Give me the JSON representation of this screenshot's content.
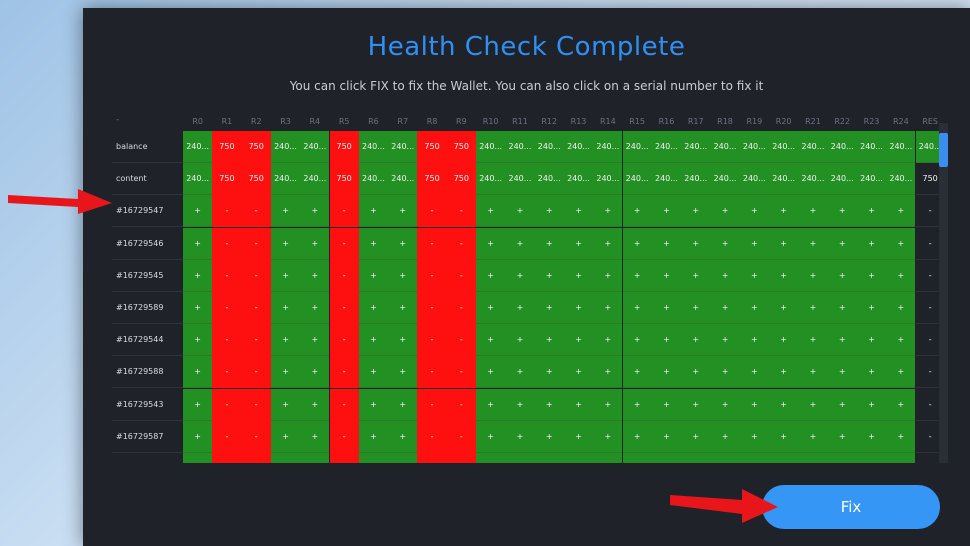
{
  "dialog": {
    "title": "Health Check Complete",
    "subtitle": "You can click FIX to fix the Wallet. You can also click on a serial number to fix it"
  },
  "table": {
    "corner": "-",
    "columns": [
      "R0",
      "R1",
      "R2",
      "R3",
      "R4",
      "R5",
      "R6",
      "R7",
      "R8",
      "R9",
      "R10",
      "R11",
      "R12",
      "R13",
      "R14",
      "R15",
      "R16",
      "R17",
      "R18",
      "R19",
      "R20",
      "R21",
      "R22",
      "R23",
      "R24",
      "RES"
    ],
    "column_status": [
      "pass",
      "fail",
      "fail",
      "pass",
      "pass",
      "fail",
      "pass",
      "pass",
      "fail",
      "fail",
      "pass",
      "pass",
      "pass",
      "pass",
      "pass",
      "pass",
      "pass",
      "pass",
      "pass",
      "pass",
      "pass",
      "pass",
      "pass",
      "pass",
      "pass",
      "none"
    ],
    "rows": [
      {
        "label": "balance",
        "cells": [
          "240...",
          "750",
          "750",
          "240...",
          "240...",
          "750",
          "240...",
          "240...",
          "750",
          "750",
          "240...",
          "240...",
          "240...",
          "240...",
          "240...",
          "240...",
          "240...",
          "240...",
          "240...",
          "240...",
          "240...",
          "240...",
          "240...",
          "240...",
          "240...",
          "240..."
        ]
      },
      {
        "label": "content",
        "cells": [
          "240...",
          "750",
          "750",
          "240...",
          "240...",
          "750",
          "240...",
          "240...",
          "750",
          "750",
          "240...",
          "240...",
          "240...",
          "240...",
          "240...",
          "240...",
          "240...",
          "240...",
          "240...",
          "240...",
          "240...",
          "240...",
          "240...",
          "240...",
          "240...",
          "750"
        ]
      },
      {
        "label": "#16729547",
        "cells": [
          "+",
          "-",
          "-",
          "+",
          "+",
          "-",
          "+",
          "+",
          "-",
          "-",
          "+",
          "+",
          "+",
          "+",
          "+",
          "+",
          "+",
          "+",
          "+",
          "+",
          "+",
          "+",
          "+",
          "+",
          "+",
          "-"
        ]
      },
      {
        "label": "#16729546",
        "cells": [
          "+",
          "-",
          "-",
          "+",
          "+",
          "-",
          "+",
          "+",
          "-",
          "-",
          "+",
          "+",
          "+",
          "+",
          "+",
          "+",
          "+",
          "+",
          "+",
          "+",
          "+",
          "+",
          "+",
          "+",
          "+",
          "-"
        ]
      },
      {
        "label": "#16729545",
        "cells": [
          "+",
          "-",
          "-",
          "+",
          "+",
          "-",
          "+",
          "+",
          "-",
          "-",
          "+",
          "+",
          "+",
          "+",
          "+",
          "+",
          "+",
          "+",
          "+",
          "+",
          "+",
          "+",
          "+",
          "+",
          "+",
          "-"
        ]
      },
      {
        "label": "#16729589",
        "cells": [
          "+",
          "-",
          "-",
          "+",
          "+",
          "-",
          "+",
          "+",
          "-",
          "-",
          "+",
          "+",
          "+",
          "+",
          "+",
          "+",
          "+",
          "+",
          "+",
          "+",
          "+",
          "+",
          "+",
          "+",
          "+",
          "-"
        ]
      },
      {
        "label": "#16729544",
        "cells": [
          "+",
          "-",
          "-",
          "+",
          "+",
          "-",
          "+",
          "+",
          "-",
          "-",
          "+",
          "+",
          "+",
          "+",
          "+",
          "+",
          "+",
          "+",
          "+",
          "+",
          "+",
          "+",
          "+",
          "+",
          "+",
          "-"
        ]
      },
      {
        "label": "#16729588",
        "cells": [
          "+",
          "-",
          "-",
          "+",
          "+",
          "-",
          "+",
          "+",
          "-",
          "-",
          "+",
          "+",
          "+",
          "+",
          "+",
          "+",
          "+",
          "+",
          "+",
          "+",
          "+",
          "+",
          "+",
          "+",
          "+",
          "-"
        ]
      },
      {
        "label": "#16729543",
        "cells": [
          "+",
          "-",
          "-",
          "+",
          "+",
          "-",
          "+",
          "+",
          "-",
          "-",
          "+",
          "+",
          "+",
          "+",
          "+",
          "+",
          "+",
          "+",
          "+",
          "+",
          "+",
          "+",
          "+",
          "+",
          "+",
          "-"
        ]
      },
      {
        "label": "#16729587",
        "cells": [
          "+",
          "-",
          "-",
          "+",
          "+",
          "-",
          "+",
          "+",
          "-",
          "-",
          "+",
          "+",
          "+",
          "+",
          "+",
          "+",
          "+",
          "+",
          "+",
          "+",
          "+",
          "+",
          "+",
          "+",
          "+",
          "-"
        ]
      }
    ],
    "balance_res_highlight": true
  },
  "fix_button": {
    "label": "Fix"
  },
  "colors": {
    "pass": "#239023",
    "fail": "#ff1010",
    "accent": "#3596f5",
    "annotation_arrow": "#e8161b"
  },
  "annotations": [
    {
      "name": "arrow-pointing-to-serial",
      "icon": "red-arrow-icon"
    },
    {
      "name": "arrow-pointing-to-fix",
      "icon": "red-arrow-icon"
    }
  ]
}
